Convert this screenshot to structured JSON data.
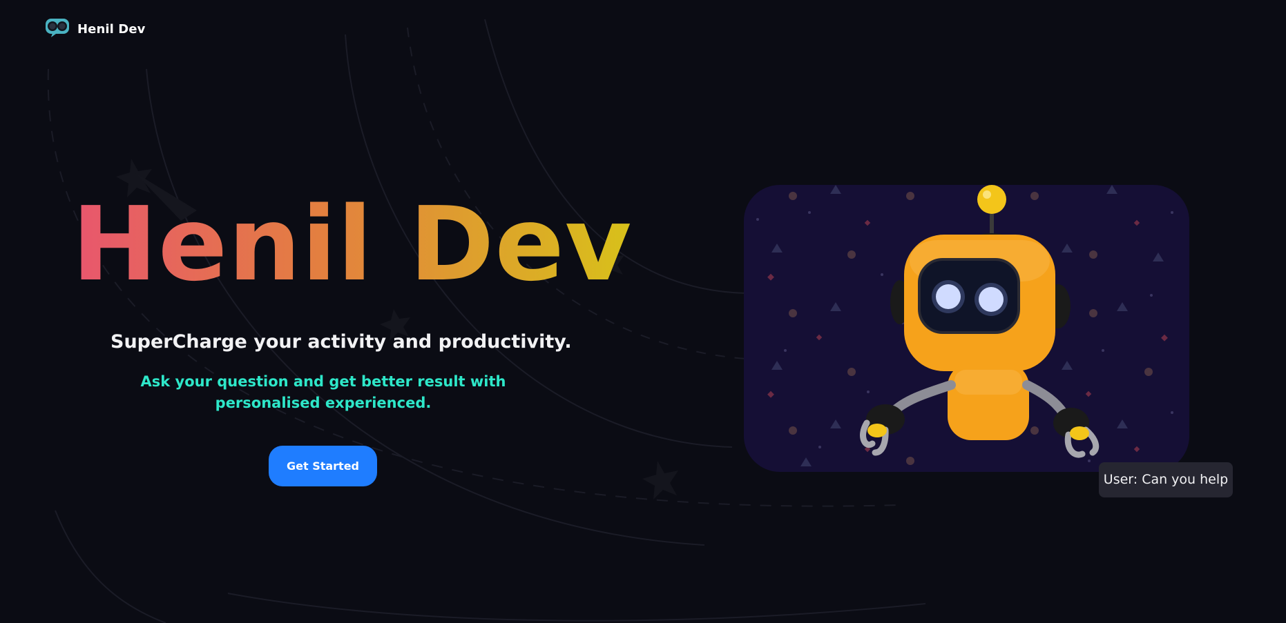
{
  "brand": {
    "name": "Henil Dev",
    "logo_icon": "robot-head-icon"
  },
  "hero": {
    "title": "Henil Dev",
    "tagline": "SuperCharge your activity and productivity.",
    "subtext": "Ask your question and get better result with personalised experienced.",
    "cta_label": "Get Started",
    "image_icon": "orange-robot-illustration"
  },
  "chat_preview": {
    "message": "User: Can you help"
  },
  "colors": {
    "background": "#0b0c14",
    "title_gradient_start": "#e8566e",
    "title_gradient_end": "#d8c11a",
    "subtext": "#2ee7c9",
    "cta": "#1f7dff",
    "card_background": "#150f35",
    "robot_body": "#f6a21b"
  }
}
